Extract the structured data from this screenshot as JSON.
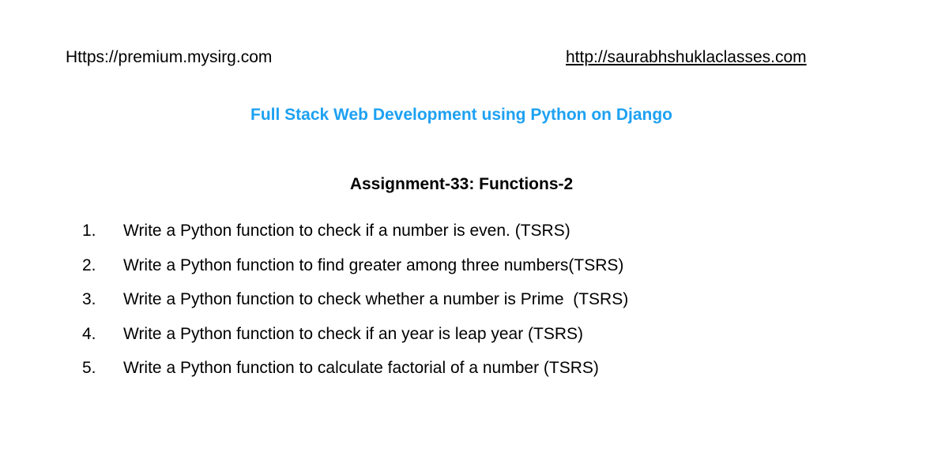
{
  "header": {
    "left_url": "Https://premium.mysirg.com",
    "right_url": "http://saurabhshuklaclasses.com"
  },
  "course_title": "Full Stack Web Development using Python on Django",
  "assignment_title": "Assignment-33: Functions-2",
  "tasks": [
    {
      "number": "1.",
      "text": "Write a Python function to check if a number is even. (TSRS)"
    },
    {
      "number": "2.",
      "text": "Write a Python function to find greater among three numbers(TSRS)"
    },
    {
      "number": "3.",
      "text": "Write a Python function to check whether a number is Prime  (TSRS)"
    },
    {
      "number": "4.",
      "text": "Write a Python function to check if an year is leap year (TSRS)"
    },
    {
      "number": "5.",
      "text": "Write a Python function to calculate factorial of a number (TSRS)"
    }
  ],
  "colors": {
    "title_blue": "#1da1f2",
    "text": "#000000",
    "background": "#ffffff"
  }
}
